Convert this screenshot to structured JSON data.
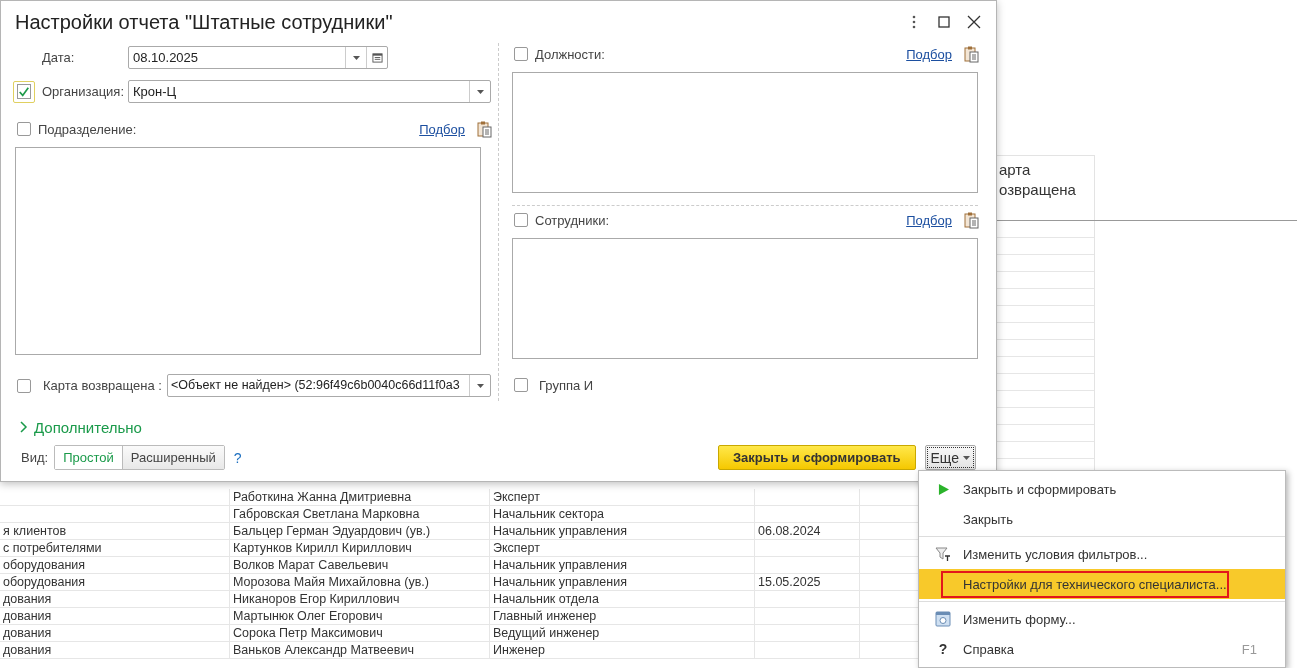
{
  "report": {
    "column_6_header": "арта озвращена",
    "rows": [
      {
        "column_2": "Работкина Жанна Дмитриевна",
        "column_3": "Эксперт"
      },
      {
        "column_2": "Габровская Светлана Марковна",
        "column_3": "Начальник сектора"
      },
      {
        "column_1": "я клиентов",
        "column_2": "Бальцер Герман Эдуардович (ув.)",
        "column_3": "Начальник управления",
        "column_4": "06.08.2024"
      },
      {
        "column_1": "с потребителями",
        "column_2": "Картунков Кирилл Кириллович",
        "column_3": "Эксперт"
      },
      {
        "column_1": "оборудования",
        "column_2": "Волков Марат Савельевич",
        "column_3": "Начальник управления"
      },
      {
        "column_1": "оборудования",
        "column_2": "Морозова Майя Михайловна (ув.)",
        "column_3": "Начальник управления",
        "column_4": "15.05.2025"
      },
      {
        "column_1": "дования",
        "column_2": "Никаноров Егор Кириллович",
        "column_3": "Начальник отдела"
      },
      {
        "column_1": "дования",
        "column_2": "Мартынюк Олег Егорович",
        "column_3": "Главный инженер"
      },
      {
        "column_1": "дования",
        "column_2": "Сорока Петр Максимович",
        "column_3": "Ведущий инженер"
      },
      {
        "column_1": "дования",
        "column_2": "Ваньков Александр Матвеевич",
        "column_3": "Инженер"
      }
    ]
  },
  "dialog": {
    "title": "Настройки отчета \"Штатные сотрудники\"",
    "date": {
      "label": "Дата:",
      "value": "08.10.2025"
    },
    "organization": {
      "label": "Организация:",
      "checked": true,
      "focused": true,
      "value": "Крон-Ц"
    },
    "subdivision": {
      "label": "Подразделение:",
      "checked": false,
      "link": "Подбор"
    },
    "card_returned": {
      "label": "Карта возвращена :",
      "checked": false,
      "value": "<Объект не найден> (52:96f49c6b0040c66d11f0a3"
    },
    "positions": {
      "label": "Должности:",
      "checked": false,
      "link": "Подбор"
    },
    "employees": {
      "label": "Сотрудники:",
      "checked": false,
      "link": "Подбор"
    },
    "group": {
      "label": "Группа И",
      "checked": false
    },
    "more_section": {
      "label": "Дополнительно",
      "expanded": false
    },
    "view": {
      "label": "Вид:",
      "options": [
        {
          "label": "Простой",
          "selected": true
        },
        {
          "label": "Расширенный",
          "selected": false
        }
      ],
      "help": "?"
    },
    "buttons": [
      {
        "label": "Закрыть и сформировать",
        "kind": "primary"
      },
      {
        "label": "Еще",
        "kind": "menu"
      }
    ]
  },
  "menu": {
    "items": [
      {
        "kind": "run",
        "label": "Закрыть и сформировать",
        "highlighted": false,
        "framed": false
      },
      {
        "kind": "plain",
        "label": "Закрыть",
        "highlighted": false,
        "framed": false
      },
      {
        "kind": "separator"
      },
      {
        "kind": "filter",
        "label": "Изменить условия фильтров...",
        "highlighted": false,
        "framed": false
      },
      {
        "kind": "plain",
        "label": "Настройки для технического специалиста...",
        "highlighted": true,
        "framed": true
      },
      {
        "kind": "separator"
      },
      {
        "kind": "form",
        "label": "Изменить форму...",
        "highlighted": false,
        "framed": false
      },
      {
        "kind": "help",
        "icon": "?",
        "label": "Справка",
        "shortcut": "F1",
        "highlighted": false,
        "framed": false
      }
    ]
  }
}
